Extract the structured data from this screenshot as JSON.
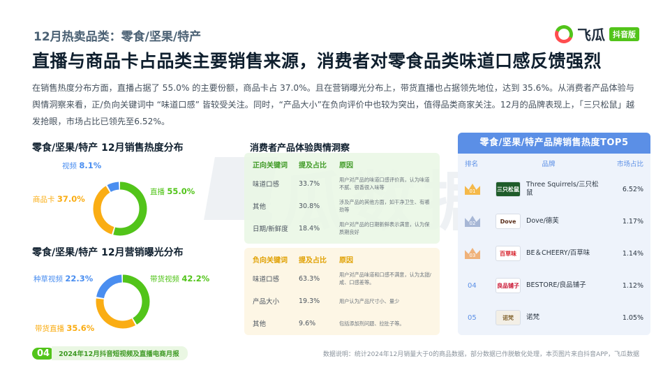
{
  "section_label": "12月热卖品类：零食/坚果/特产",
  "logo": {
    "name": "飞瓜",
    "badge": "抖音版"
  },
  "headline": "直播与商品卡占品类主要销售来源，消费者对零食品类味道口感反馈强烈",
  "summary": "在销售热度分布方面，直播占据了 55.0% 的主要份额，商品卡占 37.0%。且在营销曝光分布上，带货直播也占据领先地位，达到 35.6%。从消费者产品体验与舆情洞察来看，正/负向关键词中 “味道口感” 皆较受关注。同时，“产品大小”在负向评价中也较为突出，值得品类商家关注。12月的品牌表现上，「三只松鼠」越发抢眼，市场占比已领先至6.52%。",
  "watermark": "飞瓜数据",
  "colors": {
    "green": "#52c41a",
    "orange": "#faad14",
    "blue": "#4a8ef0"
  },
  "sales_chart": {
    "title": "零食/坚果/特产 12月销售热度分布",
    "slices": [
      {
        "label": "直播",
        "value": "55.0%",
        "pct": 55.0,
        "color": "#52c41a"
      },
      {
        "label": "商品卡",
        "value": "37.0%",
        "pct": 37.0,
        "color": "#faad14"
      },
      {
        "label": "视频",
        "value": "8.1%",
        "pct": 8.1,
        "color": "#4a8ef0"
      }
    ]
  },
  "exposure_chart": {
    "title": "零食/坚果/特产 12月营销曝光分布",
    "slices": [
      {
        "label": "带货视频",
        "value": "42.2%",
        "pct": 42.2,
        "color": "#52c41a"
      },
      {
        "label": "带货直播",
        "value": "35.6%",
        "pct": 35.6,
        "color": "#faad14"
      },
      {
        "label": "种草视频",
        "value": "22.3%",
        "pct": 22.3,
        "color": "#4a8ef0"
      }
    ]
  },
  "sentiment": {
    "title": "消费者产品体验舆情洞察",
    "positive": {
      "headers": [
        "正向关键词",
        "提及占比",
        "原因"
      ],
      "rows": [
        {
          "keyword": "味道口感",
          "share": "33.7%",
          "reason": "用户对产品的味道口感评价高，认为味道不腻、很香很入味等"
        },
        {
          "keyword": "其他",
          "share": "30.8%",
          "reason": "涉及产品的其他方面，如干净卫生、有嚼劲等"
        },
        {
          "keyword": "日期/新鲜度",
          "share": "18.4%",
          "reason": "用户对产品的日期新鲜表示满意，认为保质期良好"
        }
      ]
    },
    "negative": {
      "headers": [
        "负向关键词",
        "提及占比",
        "原因"
      ],
      "rows": [
        {
          "keyword": "味道口感",
          "share": "63.3%",
          "reason": "用户对产品味道和口感不满意，认为太甜/咸、口感差等。"
        },
        {
          "keyword": "产品大小",
          "share": "19.3%",
          "reason": "用户认为产品尺寸小、量少"
        },
        {
          "keyword": "其他",
          "share": "9.6%",
          "reason": "包括添加剂问题、拉肚子等。"
        }
      ]
    }
  },
  "ranking": {
    "title": "零食/坚果/特产品牌销售热度TOP5",
    "headers": [
      "排名",
      "品牌",
      "市场占比"
    ],
    "rows": [
      {
        "rank": "01",
        "brand": "Three Squirrels/三只松鼠",
        "share": "6.52%",
        "logo_text": "三只松鼠",
        "logo_bg": "#1f5c2a",
        "logo_fg": "#ffffff",
        "crown": "gold"
      },
      {
        "rank": "02",
        "brand": "Dove/德芙",
        "share": "1.17%",
        "logo_text": "Dove",
        "logo_bg": "#ffffff",
        "logo_fg": "#5a2e1a",
        "crown": "silver"
      },
      {
        "rank": "03",
        "brand": "BE＆CHEERY/百草味",
        "share": "1.14%",
        "logo_text": "百草味",
        "logo_bg": "#ffffff",
        "logo_fg": "#d6202a",
        "crown": "bronze"
      },
      {
        "rank": "04",
        "brand": "BESTORE/良品铺子",
        "share": "1.12%",
        "logo_text": "良品铺子",
        "logo_bg": "#ffffff",
        "logo_fg": "#c8102e",
        "crown": ""
      },
      {
        "rank": "05",
        "brand": "诺梵",
        "share": "1.05%",
        "logo_text": "诺梵",
        "logo_bg": "#f3efe6",
        "logo_fg": "#8a6d3b",
        "crown": ""
      }
    ]
  },
  "footer": {
    "page": "04",
    "report": "2024年12月抖音短视频及直播电商月报",
    "note": "数据说明：统计2024年12月销量大于0的商品数据，部分数据已作脱敏化处理，本页图片来自抖音APP，飞瓜数据"
  }
}
